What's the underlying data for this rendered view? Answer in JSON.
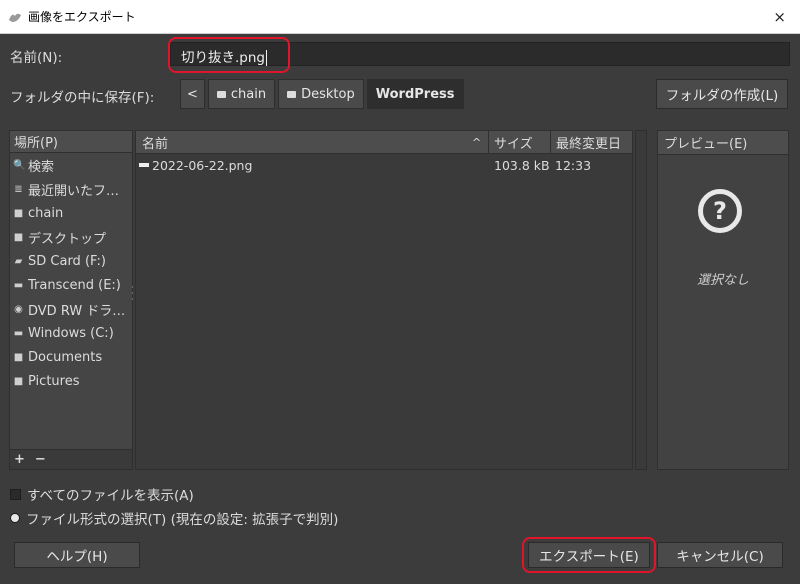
{
  "window": {
    "title": "画像をエクスポート",
    "close": "×"
  },
  "name_row": {
    "label": "名前(N):",
    "value": "切り抜き.png"
  },
  "folder_row": {
    "label": "フォルダの中に保存(F):",
    "back": "<",
    "crumbs": [
      "chain",
      "Desktop",
      "WordPress"
    ],
    "create_folder": "フォルダの作成(L)"
  },
  "places": {
    "header": "場所(P)",
    "items": [
      {
        "icon": "search-icon",
        "glyph": "🔍",
        "label": "検索"
      },
      {
        "icon": "recent-icon",
        "glyph": "≣",
        "label": "最近開いたフ…"
      },
      {
        "icon": "folder-icon",
        "glyph": "■",
        "label": "chain"
      },
      {
        "icon": "folder-icon",
        "glyph": "■",
        "label": "デスクトップ"
      },
      {
        "icon": "drive-icon",
        "glyph": "▰",
        "label": "SD Card (F:)"
      },
      {
        "icon": "drive-icon",
        "glyph": "▬",
        "label": "Transcend (E:)"
      },
      {
        "icon": "optical-drive-icon",
        "glyph": "◉",
        "label": "DVD RW ドラ…"
      },
      {
        "icon": "drive-icon",
        "glyph": "▬",
        "label": "Windows (C:)"
      },
      {
        "icon": "folder-icon",
        "glyph": "■",
        "label": "Documents"
      },
      {
        "icon": "folder-icon",
        "glyph": "■",
        "label": "Pictures"
      }
    ],
    "add": "+",
    "remove": "−"
  },
  "files": {
    "columns": {
      "name": "名前",
      "size": "サイズ",
      "modified": "最終変更日"
    },
    "sort_arrow": "^",
    "rows": [
      {
        "name": "2022-06-22.png",
        "size": "103.8 kB",
        "modified": "12:33"
      }
    ]
  },
  "preview": {
    "header": "プレビュー(E)",
    "icon_glyph": "?",
    "none": "選択なし"
  },
  "options": {
    "show_all": "すべてのファイルを表示(A)",
    "file_type": "ファイル形式の選択(T) (現在の設定: 拡張子で判別)"
  },
  "buttons": {
    "help": "ヘルプ(H)",
    "export": "エクスポート(E)",
    "cancel": "キャンセル(C)"
  },
  "colors": {
    "highlight": "#e0152a",
    "background": "#3c3c3c"
  }
}
